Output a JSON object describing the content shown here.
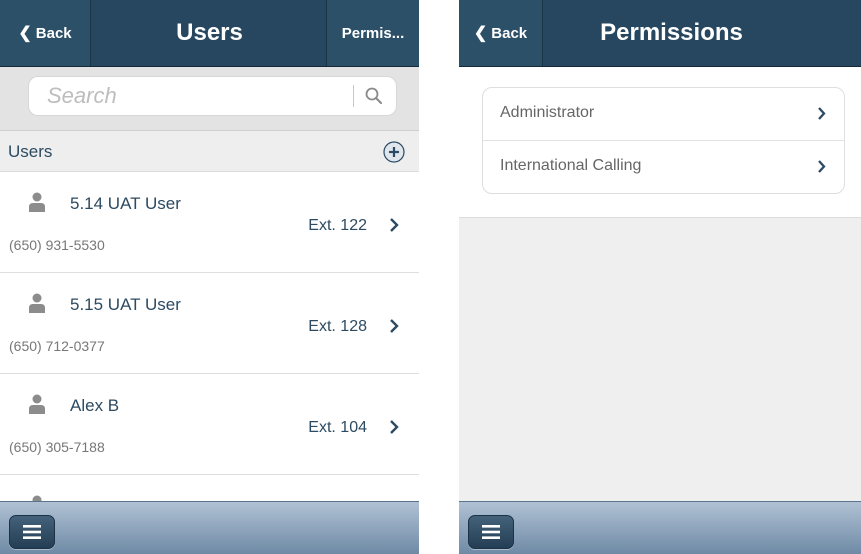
{
  "users_screen": {
    "back_label": "Back",
    "title": "Users",
    "right_label": "Permis...",
    "search_placeholder": "Search",
    "section_title": "Users",
    "users": [
      {
        "name": "5.14 UAT User",
        "phone": "(650) 931-5530",
        "ext": "Ext. 122"
      },
      {
        "name": "5.15 UAT User",
        "phone": "(650) 712-0377",
        "ext": "Ext. 128"
      },
      {
        "name": "Alex B",
        "phone": "(650) 305-7188",
        "ext": "Ext. 104"
      }
    ]
  },
  "permissions_screen": {
    "back_label": "Back",
    "title": "Permissions",
    "items": [
      {
        "label": "Administrator"
      },
      {
        "label": "International Calling"
      }
    ]
  },
  "colors": {
    "navbar": "#26475f",
    "accent_text": "#2c4a61",
    "toolbar_top": "#b0c1d4",
    "toolbar_bottom": "#6f8aa6"
  },
  "icons": [
    "back-chevron-icon",
    "search-icon",
    "add-icon",
    "person-icon",
    "chevron-right-icon",
    "menu-icon"
  ]
}
